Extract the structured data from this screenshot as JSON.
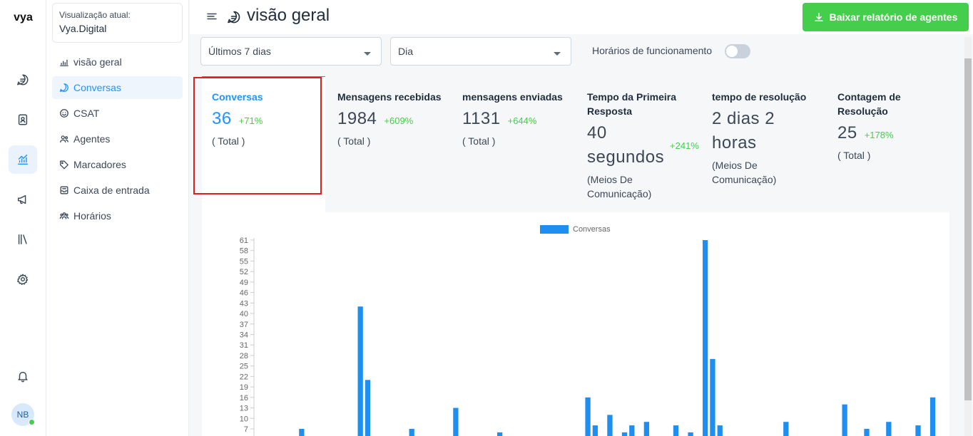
{
  "app": {
    "logo": "vya"
  },
  "rail": {
    "items": [
      {
        "icon": "chat-icon",
        "active": false
      },
      {
        "icon": "contacts-icon",
        "active": false
      },
      {
        "icon": "reports-icon",
        "active": true
      },
      {
        "icon": "campaign-icon",
        "active": false
      },
      {
        "icon": "library-icon",
        "active": false
      },
      {
        "icon": "gear-icon",
        "active": false
      }
    ],
    "notifications_icon": "bell-icon",
    "avatar_initials": "NB"
  },
  "account": {
    "caption": "Visualização atual:",
    "name": "Vya.Digital"
  },
  "sidebar": {
    "items": [
      {
        "label": "visão geral",
        "icon": "chart-icon",
        "active": false
      },
      {
        "label": "Conversas",
        "icon": "chat-icon",
        "active": true
      },
      {
        "label": "CSAT",
        "icon": "smiley-icon",
        "active": false
      },
      {
        "label": "Agentes",
        "icon": "people-icon",
        "active": false
      },
      {
        "label": "Marcadores",
        "icon": "tag-icon",
        "active": false
      },
      {
        "label": "Caixa de entrada",
        "icon": "inbox-icon",
        "active": false
      },
      {
        "label": "Horários",
        "icon": "team-icon",
        "active": false
      }
    ]
  },
  "header": {
    "title": "visão geral",
    "download_label": "Baixar relatório de agentes"
  },
  "filters": {
    "range": "Últimos 7 dias",
    "grouping": "Dia",
    "business_hours_label": "Horários de funcionamento",
    "business_hours_on": false
  },
  "metrics": [
    {
      "heading": "Conversas",
      "value": "36",
      "change": "+71%",
      "note": "( Total )"
    },
    {
      "heading": "Mensagens recebidas",
      "value": "1984",
      "change": "+609%",
      "note": "( Total )"
    },
    {
      "heading": "mensagens enviadas",
      "value": "1131",
      "change": "+644%",
      "note": "( Total )"
    },
    {
      "heading": "Tempo da Primeira Resposta",
      "value": "40 segundos",
      "change": "+241%",
      "note": "(Meios De Comunicação)"
    },
    {
      "heading": "tempo de resolução",
      "value": "2 dias 2 horas",
      "change": "",
      "note": "(Meios De Comunicação)"
    },
    {
      "heading": "Contagem de Resolução",
      "value": "25",
      "change": "+178%",
      "note": "( Total )"
    }
  ],
  "colors": {
    "accent": "#1f93ff",
    "success": "#44ce4b",
    "bar": "#1f8ef1"
  },
  "chart_data": {
    "type": "bar",
    "series": [
      {
        "name": "Conversas",
        "values": [
          0,
          0,
          0,
          0,
          0,
          0,
          7,
          0,
          0,
          0,
          0,
          0,
          0,
          0,
          42,
          21,
          0,
          0,
          0,
          0,
          0,
          7,
          0,
          0,
          0,
          0,
          0,
          13,
          0,
          0,
          0,
          0,
          0,
          6,
          0,
          0,
          0,
          0,
          0,
          0,
          0,
          0,
          0,
          0,
          0,
          16,
          8,
          0,
          11,
          0,
          6,
          8,
          0,
          9,
          0,
          0,
          0,
          8,
          0,
          6,
          0,
          61,
          27,
          8,
          0,
          0,
          0,
          0,
          0,
          0,
          0,
          0,
          9,
          0,
          0,
          0,
          0,
          0,
          0,
          0,
          14,
          0,
          0,
          7,
          0,
          0,
          9,
          0,
          0,
          0,
          8,
          0,
          16,
          0
        ]
      }
    ],
    "yticks": [
      7,
      10,
      13,
      16,
      19,
      22,
      25,
      28,
      31,
      34,
      37,
      40,
      43,
      46,
      49,
      52,
      55,
      58,
      61
    ],
    "ylim": [
      7,
      61
    ],
    "legend": "top-center",
    "grid": false
  }
}
